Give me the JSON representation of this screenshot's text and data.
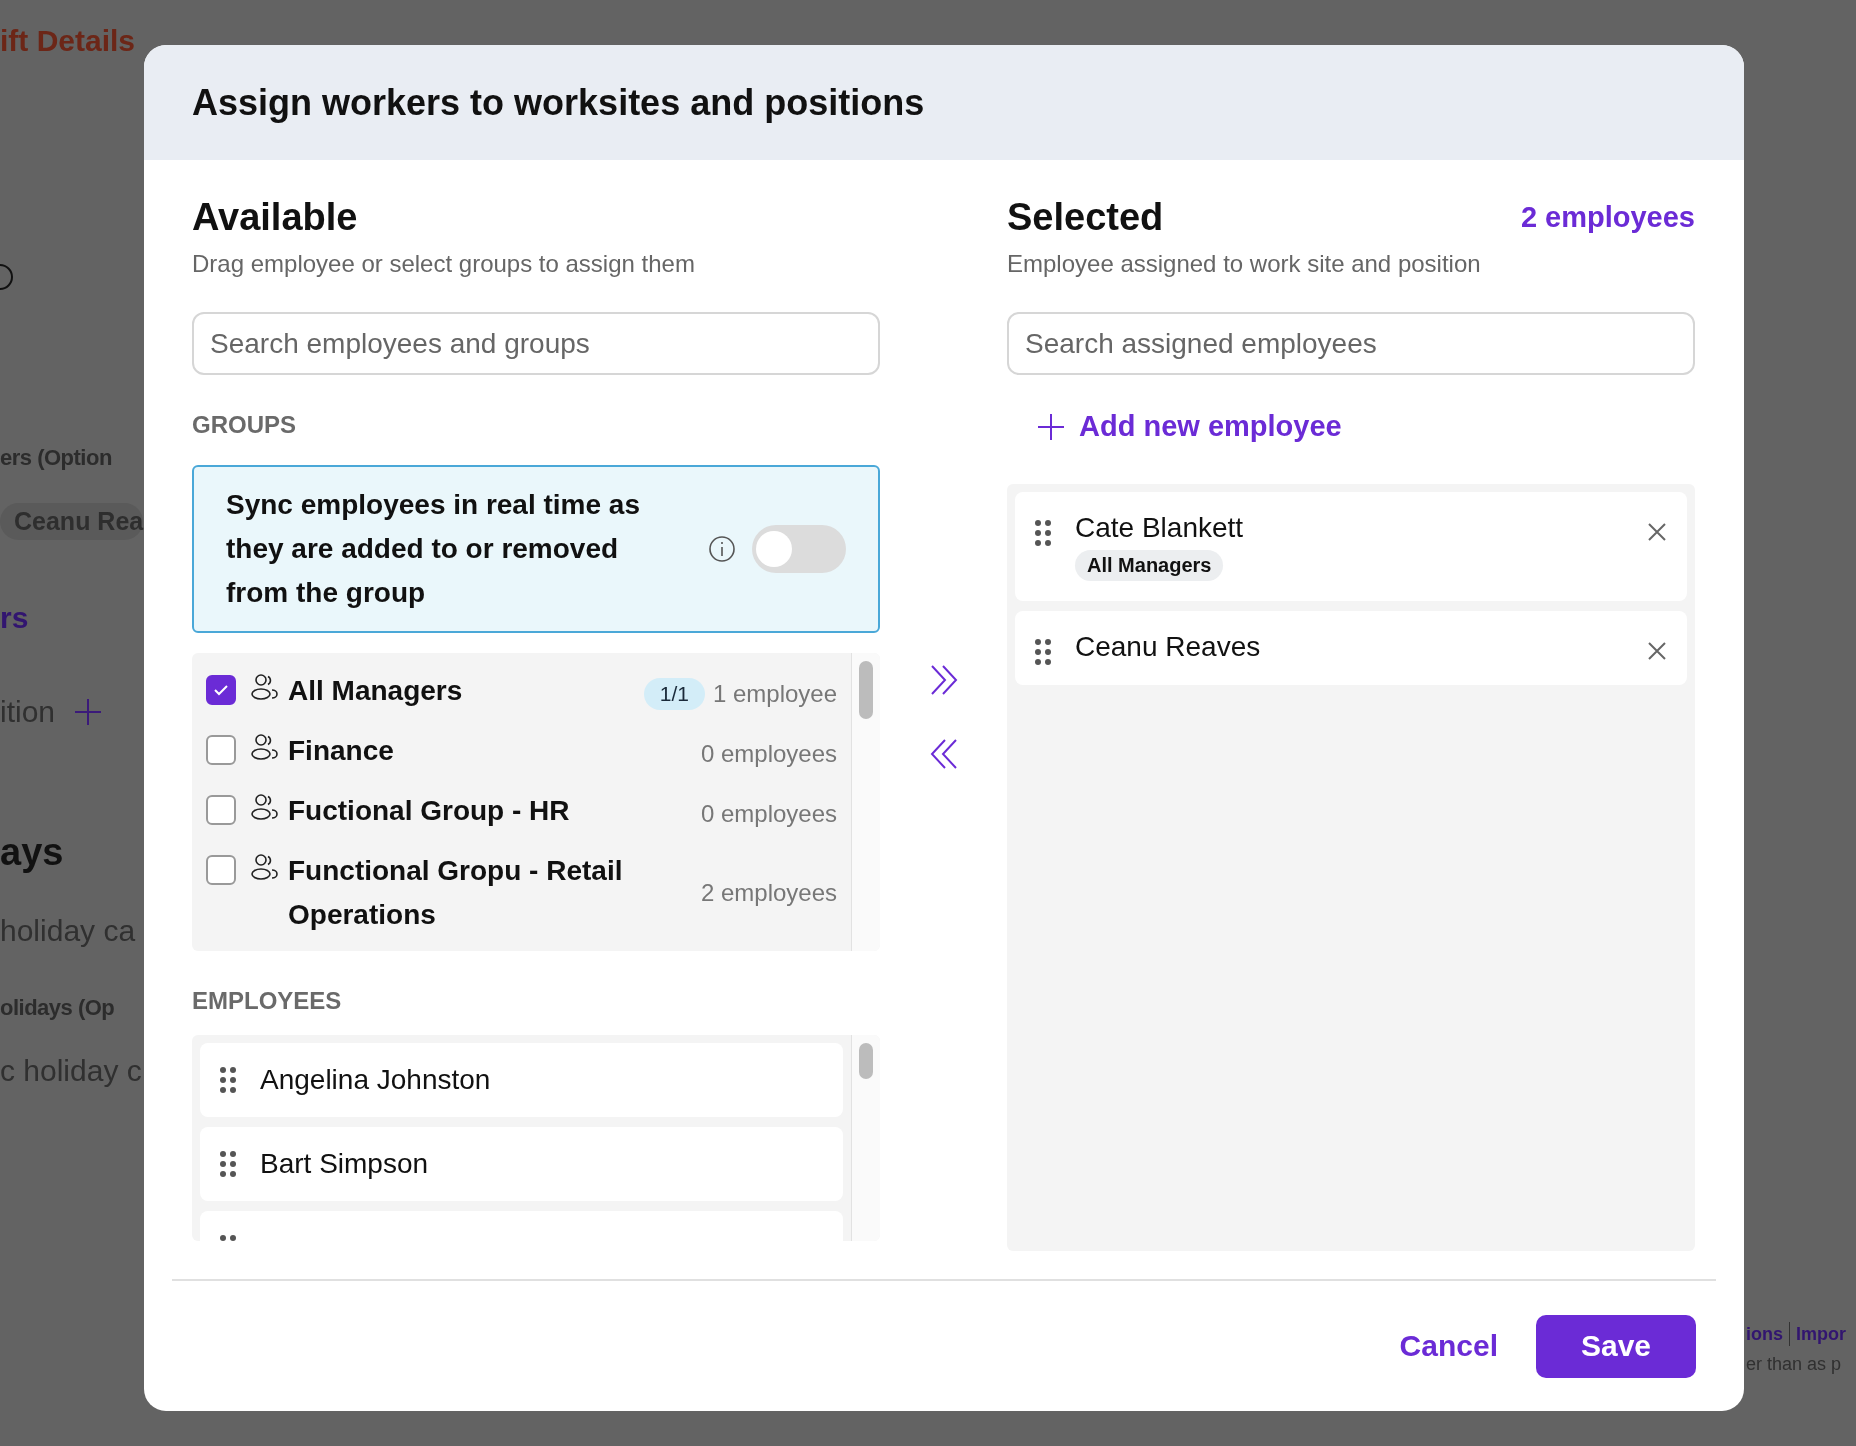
{
  "background": {
    "left": [
      {
        "kind": "title",
        "text": "ift Details"
      },
      {
        "kind": "circle"
      },
      {
        "kind": "heading",
        "text": "ers (Option"
      },
      {
        "kind": "chip",
        "text": "Ceanu Rea"
      },
      {
        "kind": "link",
        "text": "rs"
      },
      {
        "kind": "add",
        "text": "ition"
      },
      {
        "kind": "section",
        "text": "ays"
      },
      {
        "kind": "body",
        "text": "holiday ca"
      },
      {
        "kind": "heading",
        "text": "olidays (Op"
      },
      {
        "kind": "body",
        "text": "c holiday c"
      }
    ],
    "right": [
      {
        "kind": "links",
        "items": [
          "ions",
          "Impor"
        ]
      },
      {
        "kind": "body",
        "text": "er than as p"
      }
    ]
  },
  "dialog": {
    "title": "Assign workers to worksites and positions",
    "available": {
      "title": "Available",
      "subtitle": "Drag employee or select groups to assign them",
      "search": {
        "placeholder": "Search employees and groups"
      },
      "groups_label": "GROUPS",
      "sync": {
        "text": "Sync employees in real time as they are added to or removed from the group",
        "on": false
      },
      "groups": [
        {
          "name": "All Managers",
          "checked": true,
          "ratio": "1/1",
          "count": "1 employee"
        },
        {
          "name": "Finance",
          "checked": false,
          "count": "0 employees"
        },
        {
          "name": "Fuctional Group - HR",
          "checked": false,
          "count": "0 employees"
        },
        {
          "name": "Functional Gropu - Retail Operations",
          "checked": false,
          "count": "2 employees"
        }
      ],
      "employees_label": "EMPLOYEES",
      "employees": [
        {
          "name": "Angelina Johnston"
        },
        {
          "name": "Bart Simpson"
        }
      ]
    },
    "selected": {
      "title": "Selected",
      "count": "2 employees",
      "subtitle": "Employee assigned to work site and position",
      "search": {
        "placeholder": "Search assigned employees"
      },
      "add_label": "Add new employee",
      "employees": [
        {
          "name": "Cate Blankett",
          "group": "All Managers"
        },
        {
          "name": "Ceanu Reaves"
        }
      ]
    },
    "cancel": "Cancel",
    "save": "Save"
  }
}
